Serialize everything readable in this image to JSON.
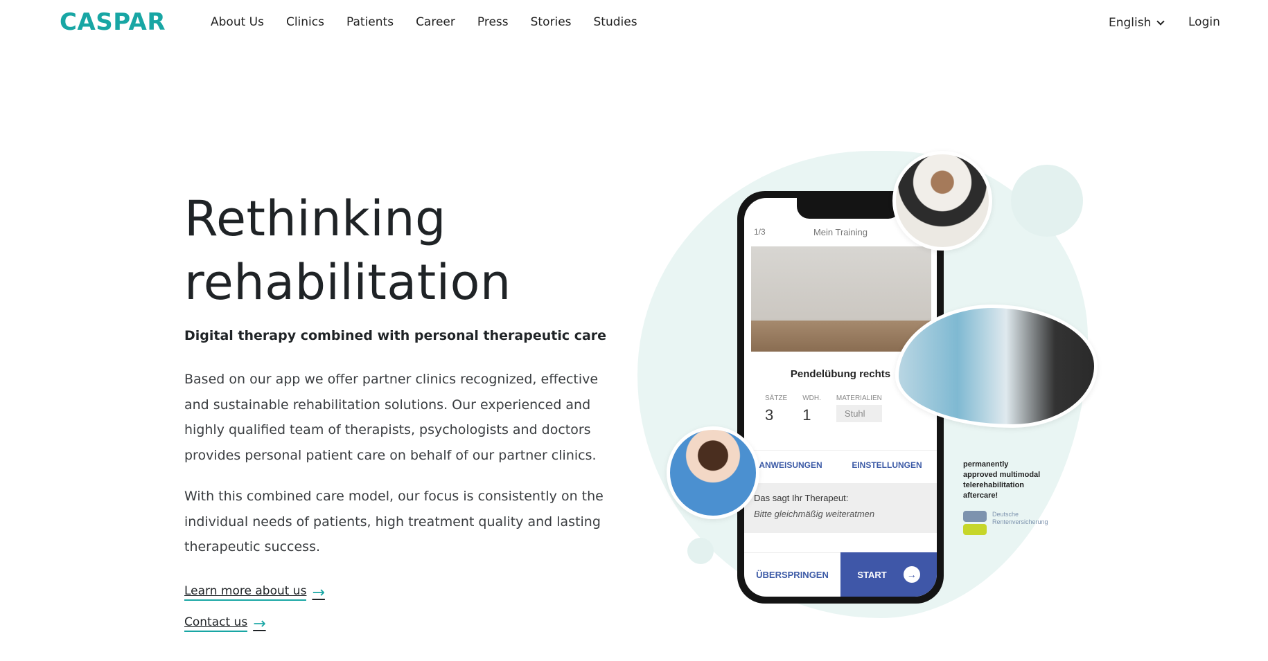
{
  "header": {
    "logo": "CASPAR",
    "nav": [
      "About Us",
      "Clinics",
      "Patients",
      "Career",
      "Press",
      "Stories",
      "Studies"
    ],
    "language": "English",
    "login": "Login"
  },
  "hero": {
    "title_line1": "Rethinking",
    "title_line2": "rehabilitation",
    "subtitle": "Digital therapy combined with personal therapeutic care",
    "paragraph1": "Based on our app we offer partner clinics recognized, effective and sustainable rehabilitation solutions. Our experienced and highly qualified team of therapists, psychologists and doctors provides personal patient care on behalf of our partner clinics.",
    "paragraph2": "With this combined care model, our focus is consistently on the individual needs of patients, high treatment quality and lasting therapeutic success.",
    "link_learn": "Learn more about us",
    "link_contact": "Contact us"
  },
  "phone": {
    "counter": "1/3",
    "header": "Mein Training",
    "exercise": "Pendelübung rechts",
    "label_sets": "SÄTZE",
    "value_sets": "3",
    "label_reps": "WDH.",
    "value_reps": "1",
    "label_material": "MATERIALIEN",
    "value_material": "Stuhl",
    "tab_instructions": "ANWEISUNGEN",
    "tab_settings": "EINSTELLUNGEN",
    "therapist_label": "Das sagt Ihr Therapeut:",
    "therapist_quote": "Bitte gleichmäßig weiteratmen",
    "skip": "ÜBERSPRINGEN",
    "start": "START"
  },
  "badge": {
    "line1": "permanently",
    "line2": "approved multimodal",
    "line3": "telerehabilitation",
    "line4": "aftercare!",
    "drv_line1": "Deutsche",
    "drv_line2": "Rentenversicherung"
  },
  "colors": {
    "brand": "#18a6a4",
    "accent_blue": "#3f57a8",
    "blob": "#e9f5f3"
  }
}
